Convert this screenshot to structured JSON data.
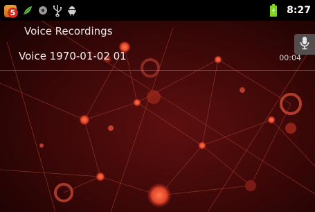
{
  "status_bar": {
    "notification_count": "5",
    "time": "8:27",
    "icons": [
      "notification-badge-icon",
      "leaf-icon",
      "media-icon",
      "usb-icon",
      "android-icon",
      "battery-charging-icon"
    ]
  },
  "app": {
    "title": "Voice Recordings"
  },
  "recordings": [
    {
      "name": "Voice 1970-01-02 01",
      "duration": "00:04"
    }
  ],
  "colors": {
    "accent": "#ff6a3c",
    "background": "#1a0303",
    "line": "#8c2a2a"
  }
}
